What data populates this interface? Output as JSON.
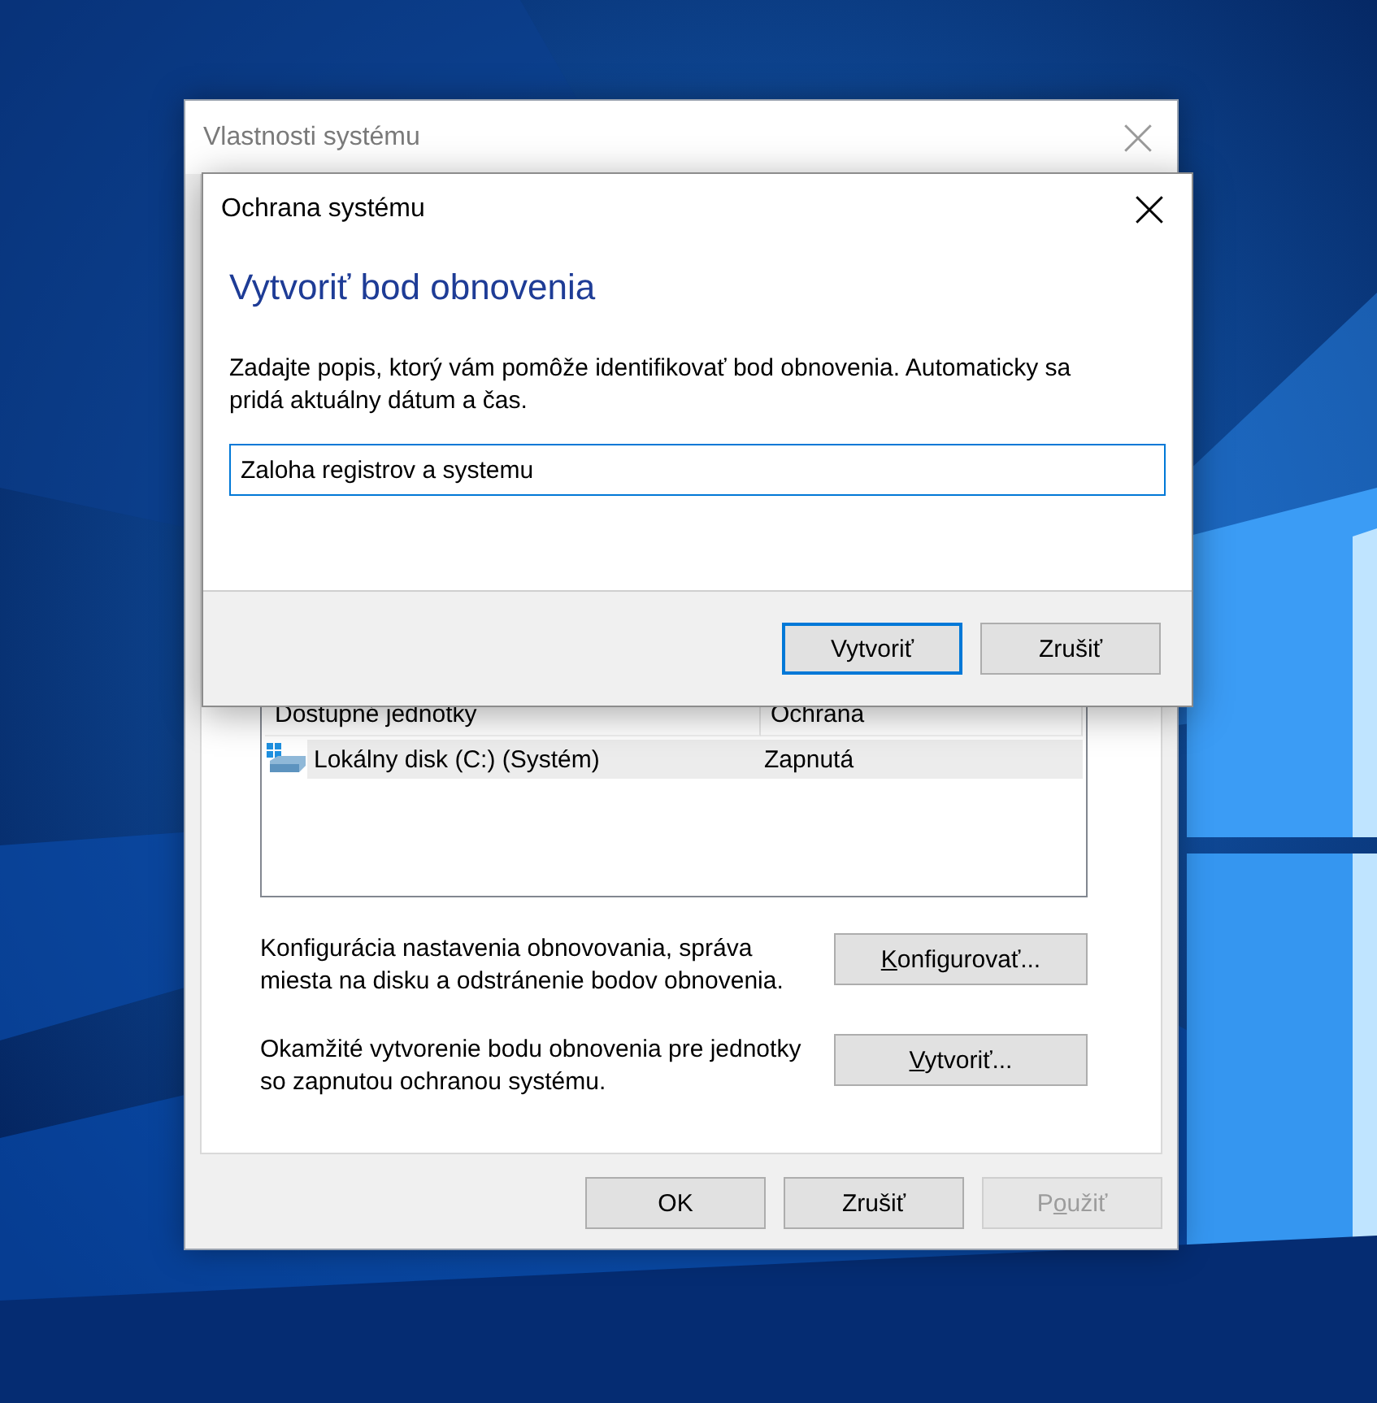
{
  "window": {
    "title": "Vlastnosti systému",
    "active": false
  },
  "drives": {
    "columns": [
      "Dostupné jednotky",
      "Ochrana"
    ],
    "rows": [
      {
        "drive": "Lokálny disk (C:) (Systém)",
        "protection": "Zapnutá",
        "selected": true
      }
    ]
  },
  "actions": [
    {
      "text": "Konfigurácia nastavenia obnovovania, správa miesta na disku a odstránenie bodov obnovenia.",
      "button": {
        "key": "K",
        "after": "onfigurovať..."
      }
    },
    {
      "text": "Okamžité vytvorenie bodu obnovenia pre jednotky so zapnutou ochranou systému.",
      "button": {
        "key": "V",
        "after": "ytvoriť..."
      }
    }
  ],
  "buttons": [
    {
      "label": {
        "before": "OK"
      },
      "disabled": false
    },
    {
      "label": {
        "before": "Zrušiť"
      },
      "disabled": false
    },
    {
      "label": {
        "before": "P",
        "key": "o",
        "after": "užiť"
      },
      "disabled": true
    }
  ],
  "dialog": {
    "title": "Ochrana systému",
    "heading": "Vytvoriť bod obnovenia",
    "description": "Zadajte popis, ktorý vám pomôže identifikovať bod obnovenia. Automaticky sa pridá aktuálny dátum a čas.",
    "input": {
      "value": "Zaloha registrov a systemu"
    },
    "buttons": [
      {
        "label": "Vytvoriť",
        "default": true
      },
      {
        "label": "Zrušiť",
        "default": false
      }
    ]
  }
}
